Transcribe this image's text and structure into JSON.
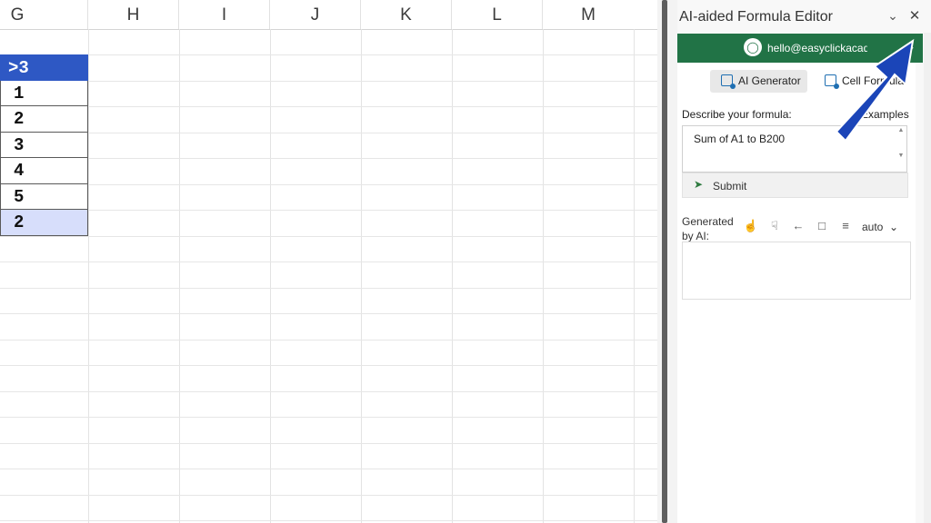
{
  "sheet": {
    "columns": [
      "G",
      "H",
      "I",
      "J",
      "K",
      "L",
      "M"
    ],
    "cells": [
      {
        "value": ">3",
        "style": "head"
      },
      {
        "value": "1",
        "style": ""
      },
      {
        "value": "2",
        "style": ""
      },
      {
        "value": "3",
        "style": ""
      },
      {
        "value": "4",
        "style": ""
      },
      {
        "value": "5",
        "style": ""
      },
      {
        "value": "2",
        "style": "total"
      }
    ]
  },
  "pane": {
    "title": "AI-aided Formula Editor",
    "collapse_icon": "chevron-down-icon",
    "close_icon": "close-icon",
    "account": {
      "email": "hello@easyclickacademy.com",
      "avatar_icon": "user-icon"
    },
    "tabs": [
      {
        "label": "AI Generator",
        "active": true
      },
      {
        "label": "Cell Formula",
        "active": false
      }
    ],
    "describe_label": "Describe your formula:",
    "examples_link": "Examples",
    "formula_value": "Sum of A1 to B200",
    "submit_label": "Submit",
    "generated_label": "Generated by AI:",
    "output_mode": "auto",
    "toolbar_icons": [
      "thumbs-up-icon",
      "thumbs-down-icon",
      "back-arrow-icon",
      "comment-icon",
      "align-icon"
    ]
  },
  "colors": {
    "accent_green": "#217346",
    "header_blue": "#2e58c4",
    "total_fill": "#d7defb",
    "arrow_blue": "#1b45b8"
  }
}
